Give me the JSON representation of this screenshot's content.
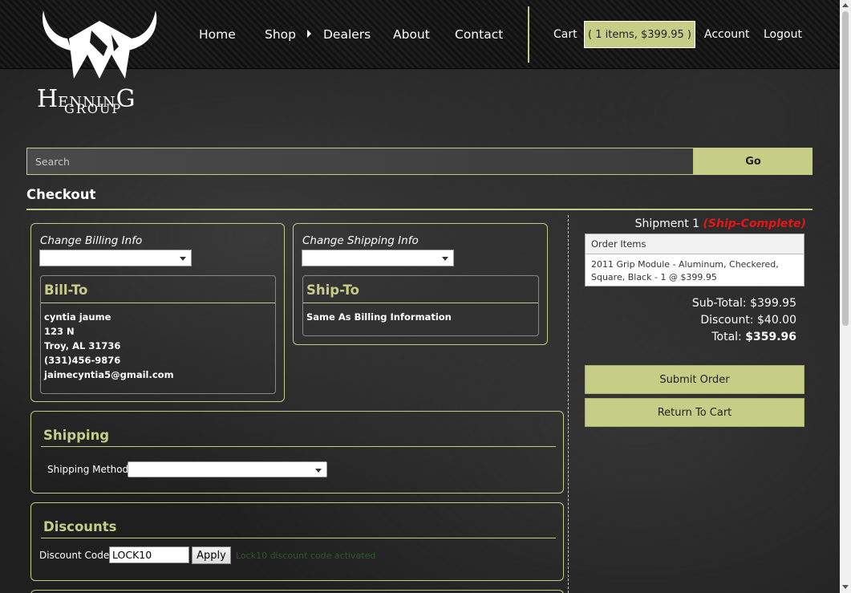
{
  "brand": {
    "logo_line1_big": "H",
    "logo_line1_rest": "ENNIN",
    "logo_line1_end": "G",
    "logo_line2": "GROUP"
  },
  "nav": {
    "items": [
      "Home",
      "Shop",
      "Dealers",
      "About",
      "Contact"
    ],
    "cart_label": "Cart",
    "cart_summary": "( 1 items, $399.95 )",
    "account_label": "Account",
    "logout_label": "Logout"
  },
  "search": {
    "placeholder": "Search",
    "go_label": "Go"
  },
  "page": {
    "title": "Checkout"
  },
  "billing": {
    "change_label": "Change Billing Info",
    "heading": "Bill-To",
    "lines": [
      "cyntia jaume",
      "123 N",
      "Troy, AL 31736",
      "(331)456-9876",
      "jaimecyntia5@gmail.com"
    ]
  },
  "shipping_info": {
    "change_label": "Change Shipping Info",
    "heading": "Ship-To",
    "text": "Same As Billing Information"
  },
  "shipping": {
    "heading": "Shipping",
    "method_label": "Shipping Method:"
  },
  "discounts": {
    "heading": "Discounts",
    "code_label": "Discount Code:",
    "code_value": "LOCK10",
    "apply_label": "Apply",
    "message": "Lock10 discount code activated"
  },
  "summary": {
    "shipment_label": "Shipment 1",
    "shipment_status": "(Ship-Complete)",
    "order_items_header": "Order Items",
    "order_line": "2011 Grip Module - Aluminum, Checkered, Square, Black  - 1 @ $399.95",
    "subtotal_label": "Sub-Total:",
    "subtotal_value": "$399.95",
    "discount_label": "Discount:",
    "discount_value": "$40.00",
    "total_label": "Total:",
    "total_value": "$359.96",
    "submit_label": "Submit Order",
    "return_label": "Return To Cart"
  },
  "colors": {
    "accent": "#c5cd87",
    "ship_complete": "#e51515",
    "background": "#1f1f1f"
  }
}
